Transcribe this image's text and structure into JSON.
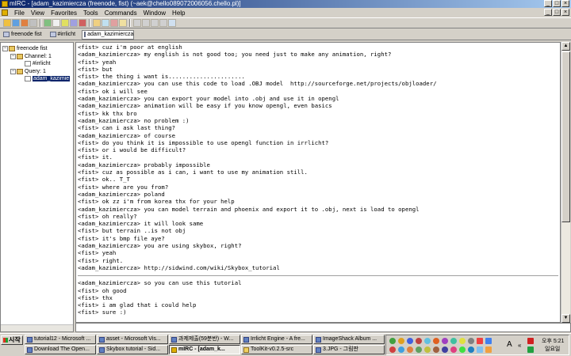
{
  "window": {
    "title": "mIRC - [adam_kazimiercza (freenode, fist) (~aek@chello089072006056.chello.pl)]",
    "btn_min": "_",
    "btn_max": "□",
    "btn_close": "×"
  },
  "menu": [
    "File",
    "View",
    "Favorites",
    "Tools",
    "Commands",
    "Window",
    "Help"
  ],
  "switchbar": [
    "freenode fist",
    "#irrlicht",
    "adam_kazimiercza"
  ],
  "tree": {
    "server": "freenode fist",
    "channels": "Channel: 1",
    "channel_item": "#irrlicht",
    "queries": "Query: 1",
    "query_item": "adam_kazimie"
  },
  "chat_before": [
    "<fist> cuz i'm poor at english",
    "<adam_kazimiercza> my english is not good too; you need just to make any animation, right?",
    "<fist> yeah",
    "<fist> but",
    "<fist> the thing i want is......................",
    "<adam_kazimiercza> you can use this code to load .OBJ model  http://sourceforge.net/projects/objloader/",
    "<fist> ok i will see",
    "<adam_kazimiercza> you can export your model into .obj and use it in opengl",
    "<adam_kazimiercza> animation will be easy if you know opengl, even basics",
    "<fist> kk thx bro",
    "<adam_kazimiercza> no problem :)",
    "<fist> can i ask last thing?",
    "<adam_kazimiercza> of course",
    "<fist> do you think it is impossible to use opengl function in irrlicht?",
    "<fist> or i would be difficult?",
    "<fist> it.",
    "<adam_kazimiercza> probably impossible",
    "<fist> cuz as possible as i can, i want to use my animation still.",
    "<fist> ok.. T_T",
    "<fist> where are you from?",
    "<adam_kazimiercza> poland",
    "<fist> ok zz i'm from korea thx for your help",
    "<adam_kazimiercza> you can model terrain and phoenix and export it to .obj, next is load to opengl",
    "<fist> oh really?",
    "<adam_kazimiercza> it will look same",
    "<fist> but terrain ..is not obj",
    "<fist> it's bmp file aye?",
    "<adam_kazimiercza> you are using skybox, right?",
    "<fist> yeah",
    "<fist> right.",
    "<adam_kazimiercza> http://sidwind.com/wiki/Skybox_tutorial"
  ],
  "chat_after": [
    "<adam_kazimiercza> so you can use this tutorial",
    "<fist> oh good",
    "<fist> thx",
    "<fist> i am glad that i could help",
    "<fist> sure :)"
  ],
  "taskbar": {
    "start": "시작",
    "row1": [
      "tutorial12 - Microsoft ...",
      "asset - Microsoft Vis...",
      "과제제출(59분반) - W...",
      "Irrlicht Engine - A fre...",
      "ImageShack Album ..."
    ],
    "row2": [
      "Download The Open...",
      "Skybox tutorial - Sid...",
      "mIRC - [adam_k...",
      "ToolKit-v0.2.5-src",
      "3.JPG - 그림판"
    ],
    "ime": "A",
    "time": "오후 5:21",
    "day": "일요일"
  }
}
